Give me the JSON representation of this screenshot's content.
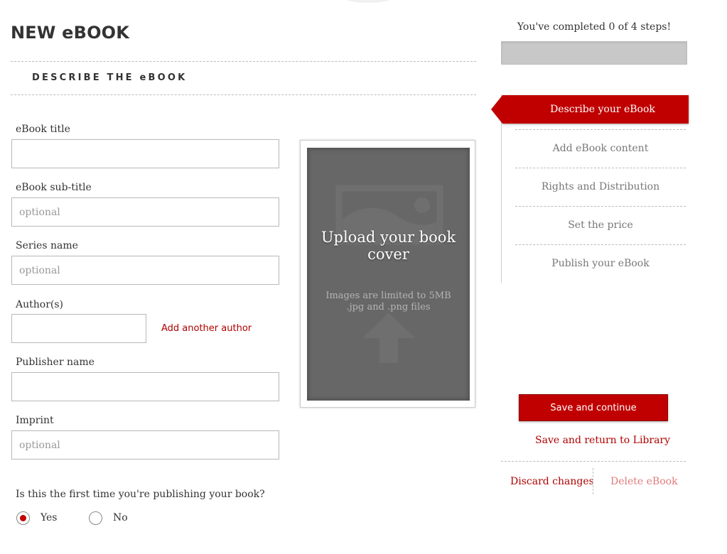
{
  "page": {
    "title": "NEW eBOOK",
    "section_heading": "DESCRIBE THE eBOOK"
  },
  "form": {
    "title_label": "eBook title",
    "title_value": "",
    "subtitle_label": "eBook sub-title",
    "subtitle_placeholder": "optional",
    "series_label": "Series name",
    "series_placeholder": "optional",
    "authors_label": "Author(s)",
    "author_value": "",
    "add_author": "Add another author",
    "publisher_label": "Publisher name",
    "publisher_value": "",
    "imprint_label": "Imprint",
    "imprint_placeholder": "optional",
    "first_time_question": "Is this the first time you're publishing your book?",
    "options": [
      {
        "label": "Yes",
        "checked": true
      },
      {
        "label": "No",
        "checked": false
      }
    ]
  },
  "cover": {
    "title": "Upload your book cover",
    "note_line1": "Images are limited to 5MB",
    "note_line2": ".jpg and .png files",
    "icons": [
      "image-placeholder-icon",
      "upload-arrow-icon"
    ]
  },
  "progress": {
    "text": "You've completed 0 of 4 steps!",
    "completed": 0,
    "total": 4
  },
  "steps": [
    {
      "label": "Describe your eBook",
      "active": true
    },
    {
      "label": "Add eBook content",
      "active": false
    },
    {
      "label": "Rights and Distribution",
      "active": false
    },
    {
      "label": "Set the price",
      "active": false
    },
    {
      "label": "Publish your eBook",
      "active": false
    }
  ],
  "actions": {
    "save_continue": "Save and continue",
    "save_return": "Save and return to Library",
    "discard": "Discard changes",
    "delete": "Delete eBook"
  },
  "colors": {
    "accent": "#c00000",
    "cover_bg": "#676767",
    "progress_track": "#c8c8c8",
    "muted_link": "#e07b7b"
  }
}
